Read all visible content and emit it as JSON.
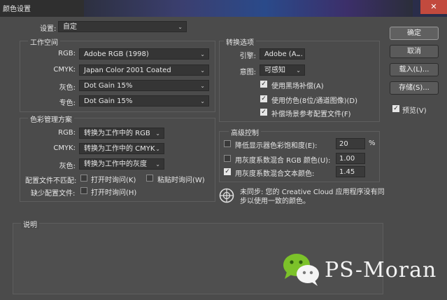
{
  "window": {
    "title": "颜色设置",
    "close_glyph": "✕"
  },
  "settings": {
    "label": "设置:",
    "value": "自定"
  },
  "working_spaces": {
    "title": "工作空间",
    "rows": [
      {
        "label": "RGB:",
        "value": "Adobe RGB (1998)"
      },
      {
        "label": "CMYK:",
        "value": "Japan Color 2001 Coated"
      },
      {
        "label": "灰色:",
        "value": "Dot Gain 15%"
      },
      {
        "label": "专色:",
        "value": "Dot Gain 15%"
      }
    ]
  },
  "color_policies": {
    "title": "色彩管理方案",
    "rows": [
      {
        "label": "RGB:",
        "value": "转换为工作中的 RGB"
      },
      {
        "label": "CMYK:",
        "value": "转换为工作中的 CMYK"
      },
      {
        "label": "灰色:",
        "value": "转换为工作中的灰度"
      }
    ],
    "mismatch_label": "配置文件不匹配:",
    "ask_open": "打开时询问(K)",
    "ask_paste": "粘贴时询问(W)",
    "missing_label": "缺少配置文件:",
    "ask_open_missing": "打开时询问(H)"
  },
  "conversion": {
    "title": "转换选项",
    "engine_label": "引擎:",
    "engine_value": "Adobe (A...",
    "intent_label": "意图:",
    "intent_value": "可感知",
    "options": [
      {
        "label": "使用黑场补偿(A)",
        "checked": true
      },
      {
        "label": "使用仿色(8位/通道图像)(D)",
        "checked": true
      },
      {
        "label": "补偿场景参考配置文件(F)",
        "checked": true
      }
    ]
  },
  "advanced": {
    "title": "高级控制",
    "rows": [
      {
        "label": "降低显示器色彩饱和度(E):",
        "value": "20",
        "unit": "%",
        "checked": false
      },
      {
        "label": "用灰度系数混合 RGB 颜色(U):",
        "value": "1.00",
        "unit": "",
        "checked": false
      },
      {
        "label": "用灰度系数混合文本颜色:",
        "value": "1.45",
        "unit": "",
        "checked": true
      }
    ]
  },
  "sync": {
    "icon": "creative-cloud-sync-icon",
    "text_line1": "未同步: 您的 Creative Cloud 应用程序没有同",
    "text_line2": "步以使用一致的颜色。"
  },
  "description": {
    "title": "说明"
  },
  "buttons": {
    "ok": "确定",
    "cancel": "取消",
    "load": "载入(L)...",
    "save": "存储(S)...",
    "preview": "预览(V)",
    "preview_checked": true
  },
  "watermark": {
    "text": "PS-Moran",
    "icon": "wechat-icon"
  },
  "colors": {
    "bg": "#4b4b4b",
    "field": "#353535",
    "wechat_green": "#7cc22a"
  }
}
